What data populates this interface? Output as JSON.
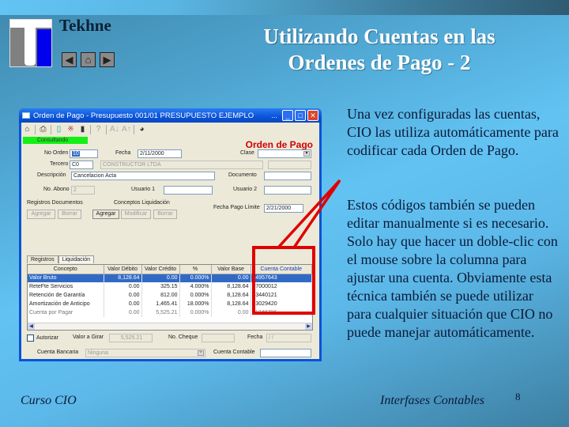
{
  "header": {
    "brand": "Tekhne",
    "nav": {
      "prev_icon": "◀",
      "home_icon": "⌂",
      "next_icon": "▶"
    },
    "title_line1": "Utilizando Cuentas en las",
    "title_line2": "Ordenes de Pago - 2"
  },
  "body": {
    "para1": "Una vez configuradas las cuentas, CIO las utiliza automáticamente para codificar cada Orden de Pago.",
    "para2": "Estos códigos también se pueden editar manualmente si es necesario. Solo hay que hacer un doble-clic con el mouse sobre la columna para ajustar una cuenta. Obviamente esta técnica también se puede utilizar para cualquier situación que CIO no puede manejar automáticamente."
  },
  "footer": {
    "left": "Curso CIO",
    "right": "Interfases Contables",
    "page_number": "8"
  },
  "window": {
    "title": "Orden de Pago - Presupuesto 001/01 PRESUPUESTO EJEMPLO",
    "title_dots": "...",
    "status": "Consultando",
    "form_title": "Orden de Pago",
    "toolbar_icons": [
      "open-icon",
      "print-icon",
      "new-icon",
      "delete-mark-icon",
      "trash-icon",
      "help-icon",
      "sort-asc-icon",
      "sort-desc-icon",
      "view-icon"
    ],
    "fields": {
      "no_orden_label": "No Orden",
      "no_orden_value": "10",
      "fecha_label": "Fecha",
      "fecha_value": "2/11/2000",
      "clase_label": "Clase",
      "clase_value": "",
      "tercero_label": "Tercero",
      "tercero_code": "C0",
      "tercero_name": "CONSTRUCTOR LTDA",
      "descripcion_label": "Descripción",
      "descripcion_value": "Cancelacion Acta",
      "documento_label": "Documento",
      "documento_value": "",
      "no_abono_label": "No. Abono",
      "no_abono_value": "2",
      "usuario1_label": "Usuario 1",
      "usuario1_value": "",
      "usuario2_label": "Usuario 2",
      "usuario2_value": "",
      "fecha_pago_label": "Fecha Pago Límite",
      "fecha_pago_value": "2/21/2000",
      "valor_girar_label": "Valor a Girar",
      "valor_girar_value": "5,525.21",
      "no_cheque_label": "No. Cheque",
      "no_cheque_value": "",
      "fecha2_label": "Fecha",
      "fecha2_value": "/ /",
      "autorizar_label": "Autorizar",
      "cuenta_bancaria_label": "Cuenta Bancaria",
      "cuenta_bancaria_value": "Ninguna",
      "cuenta_contable_label": "Cuenta Contable",
      "cuenta_contable_value": ""
    },
    "registros_label": "Registros Documentos",
    "conceptos_label": "Conceptos Liquidación",
    "buttons": {
      "reg_agregar": "Agregar",
      "reg_borrar": "Borrar",
      "con_agregar": "Agregar",
      "con_modificar": "Modificar",
      "con_borrar": "Borrar"
    },
    "tabs": [
      "Registros",
      "Liquidación"
    ],
    "grid": {
      "columns": [
        "Concepto",
        "Valor Débito",
        "Valor Crédito",
        "%",
        "Valor Base",
        "Cuenta Contable"
      ],
      "rows": [
        [
          "Valor Bruto",
          "8,128.64",
          "0.00",
          "0.000%",
          "0.00",
          "24957643"
        ],
        [
          "ReteFte Servicios",
          "0.00",
          "325.15",
          "4.000%",
          "8,128.64",
          "07000012"
        ],
        [
          "Retención de Garantía",
          "0.00",
          "812.00",
          "0.000%",
          "8,128.64",
          "43440121"
        ],
        [
          "Amortización de Anticipo",
          "0.00",
          "1,465.41",
          "18.000%",
          "8,128.64",
          "23029420"
        ],
        [
          "Cuenta por Pagar",
          "0.00",
          "5,525.21",
          "0.000%",
          "0.00",
          "11340796"
        ]
      ]
    }
  },
  "colors": {
    "highlight": "#e00000",
    "status_green": "#14f014",
    "form_title": "#d10000",
    "selection": "#316ac5"
  }
}
